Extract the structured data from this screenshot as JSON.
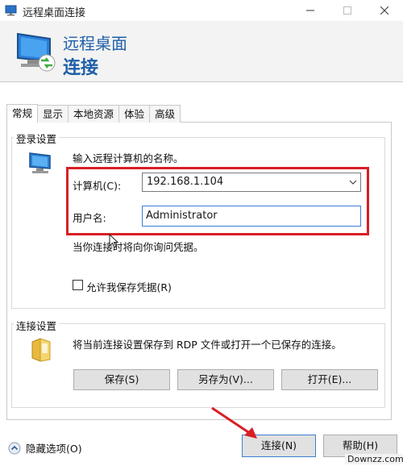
{
  "window": {
    "title": "远程桌面连接",
    "icon": "remote-desktop-icon"
  },
  "banner": {
    "line1": "远程桌面",
    "line2": "连接"
  },
  "tabs": [
    {
      "label": "常规",
      "active": true
    },
    {
      "label": "显示"
    },
    {
      "label": "本地资源"
    },
    {
      "label": "体验"
    },
    {
      "label": "高级"
    }
  ],
  "login": {
    "group_title": "登录设置",
    "intro": "输入远程计算机的名称。",
    "computer_label": "计算机(C):",
    "computer_value": "192.168.1.104",
    "username_label": "用户名:",
    "username_value": "Administrator",
    "prompt_text": "当你连接时将向你询问凭据。",
    "save_credentials_label": "允许我保存凭据(R)",
    "save_credentials_checked": false
  },
  "connection": {
    "group_title": "连接设置",
    "description": "将当前连接设置保存到 RDP 文件或打开一个已保存的连接。",
    "save_label": "保存(S)",
    "save_as_label": "另存为(V)...",
    "open_label": "打开(E)..."
  },
  "footer": {
    "hide_options_label": "隐藏选项(O)",
    "connect_label": "连接(N)",
    "help_label": "帮助(H)"
  },
  "watermark": "Downzz.com",
  "colors": {
    "accent": "#1f5fa8",
    "highlight": "#d81f26"
  }
}
